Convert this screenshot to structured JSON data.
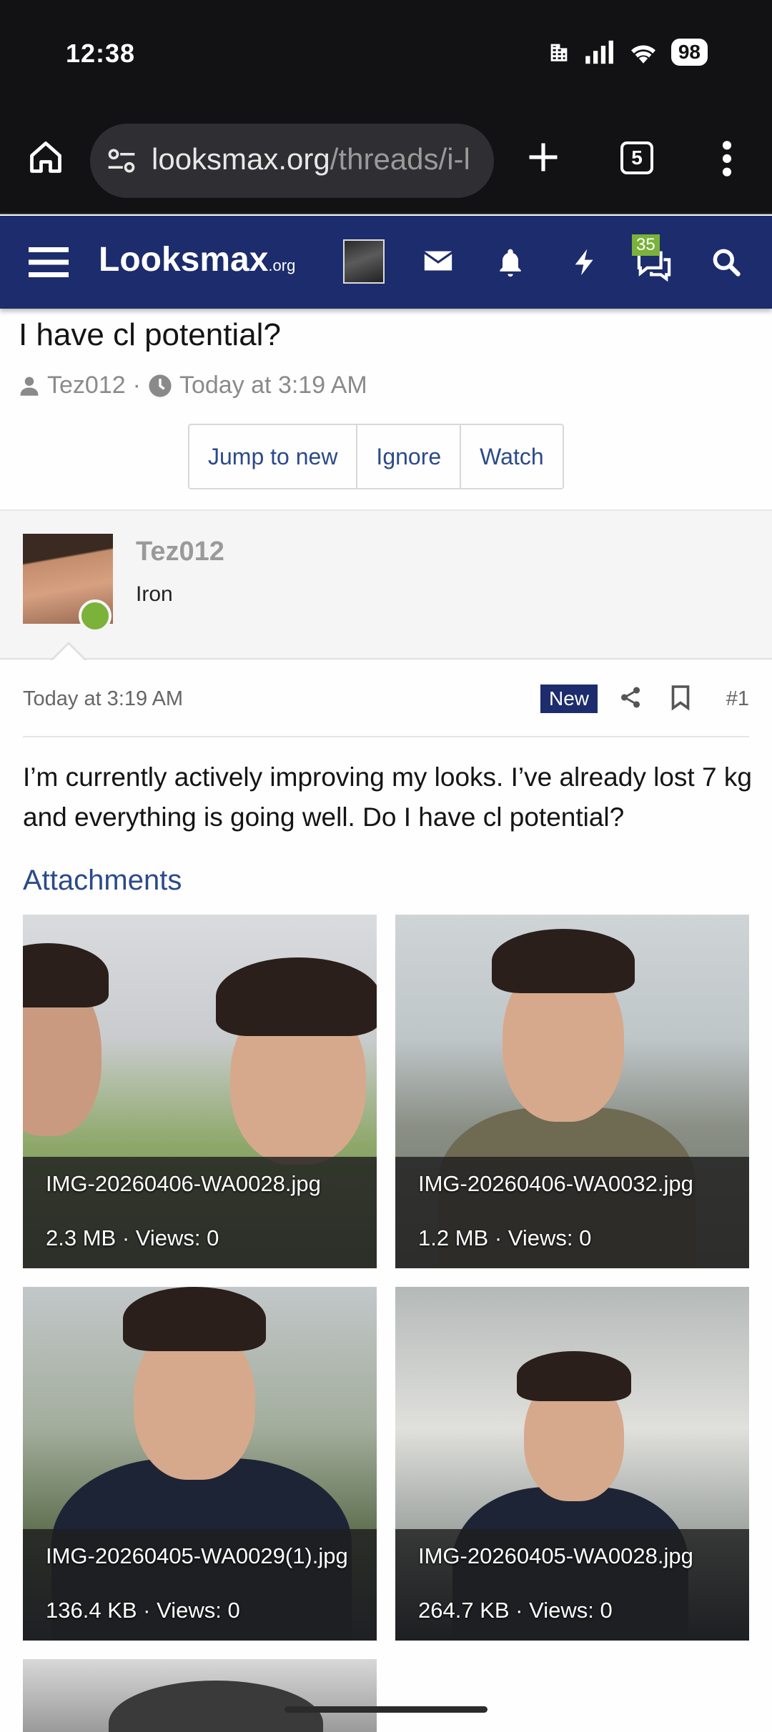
{
  "status_bar": {
    "time": "12:38",
    "battery": "98"
  },
  "browser": {
    "url_host": "looksmax.org",
    "url_path": "/threads/i-l",
    "tab_count": "5"
  },
  "forum": {
    "logo_main": "Looksmax",
    "logo_suffix": ".org",
    "conversations_badge": "35"
  },
  "thread": {
    "title": "I have cl potential?",
    "author": "Tez012",
    "separator": "·",
    "date": "Today at 3:19 AM",
    "buttons": [
      "Jump to new",
      "Ignore",
      "Watch"
    ]
  },
  "post": {
    "username": "Tez012",
    "user_title": "Iron",
    "date": "Today at 3:19 AM",
    "new_badge": "New",
    "number": "#1",
    "body": "I’m currently actively improving my looks. I’ve already lost 7 kg and everything is going well. Do I have cl potential?",
    "attachments_heading": "Attachments",
    "attachments": [
      {
        "name": "IMG-20260406-WA0028.jpg",
        "info": "2.3 MB · Views: 0"
      },
      {
        "name": "IMG-20260406-WA0032.jpg",
        "info": "1.2 MB · Views: 0"
      },
      {
        "name": "IMG-20260405-WA0029(1).jpg",
        "info": "136.4 KB · Views: 0"
      },
      {
        "name": "IMG-20260405-WA0028.jpg",
        "info": "264.7 KB · Views: 0"
      }
    ]
  },
  "colors": {
    "forum_header": "#1c2c6c",
    "link": "#2b4a8a",
    "online": "#7ab23a",
    "browser_bg": "#121214"
  },
  "icons": [
    "home-icon",
    "site-settings-icon",
    "new-tab-icon",
    "tab-switcher-icon",
    "overflow-menu-icon",
    "hamburger-icon",
    "mail-icon",
    "bell-icon",
    "bolt-icon",
    "chat-icon",
    "search-icon",
    "user-icon",
    "clock-icon",
    "share-icon",
    "bookmark-icon"
  ]
}
